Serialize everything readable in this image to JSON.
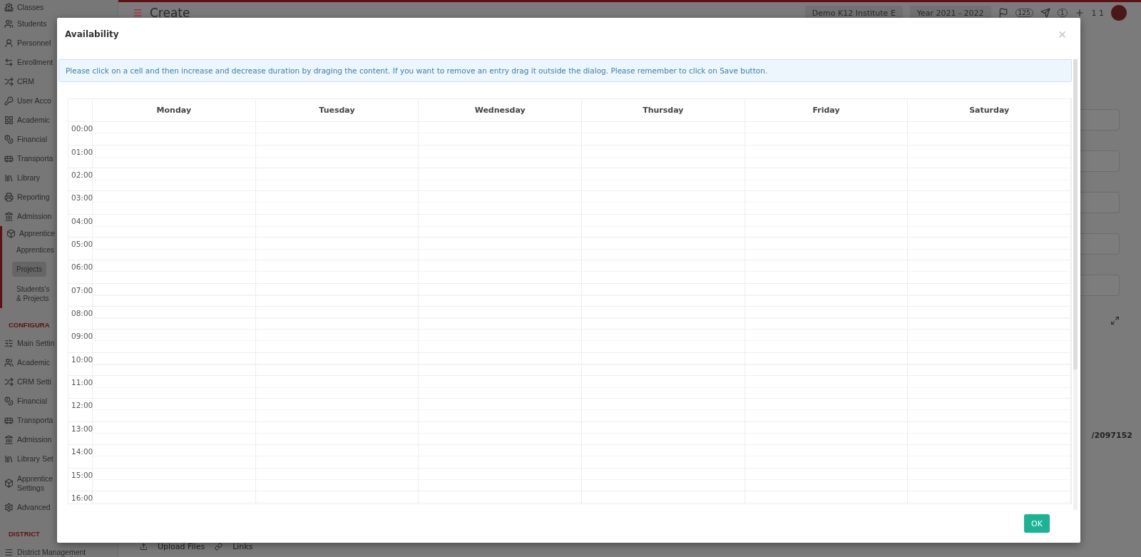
{
  "sidebar": {
    "items": [
      {
        "kind": "item",
        "label": "Classes"
      },
      {
        "kind": "item",
        "label": "Students"
      },
      {
        "kind": "item",
        "label": "Personnel"
      },
      {
        "kind": "item",
        "label": "Enrollment"
      },
      {
        "kind": "item",
        "label": "CRM"
      },
      {
        "kind": "item",
        "label": "User Acco"
      },
      {
        "kind": "item",
        "label": "Academic"
      },
      {
        "kind": "item",
        "label": "Financial"
      },
      {
        "kind": "item",
        "label": "Transporta"
      },
      {
        "kind": "item",
        "label": "Library"
      },
      {
        "kind": "item",
        "label": "Reporting"
      },
      {
        "kind": "item",
        "label": "Admission"
      },
      {
        "kind": "group",
        "label": "Apprentice",
        "expanded": true,
        "children": [
          {
            "label": "Apprentices",
            "selected": false
          },
          {
            "label": "Projects",
            "selected": true
          },
          {
            "label": "Students's\n& Projects",
            "selected": false
          }
        ]
      },
      {
        "kind": "section",
        "label": "CONFIGURA"
      },
      {
        "kind": "item",
        "label": "Main Settin"
      },
      {
        "kind": "item",
        "label": "Academic"
      },
      {
        "kind": "item",
        "label": "CRM Setti"
      },
      {
        "kind": "item",
        "label": "Financial"
      },
      {
        "kind": "item",
        "label": "Transporta"
      },
      {
        "kind": "item",
        "label": "Admission"
      },
      {
        "kind": "item",
        "label": "Library Set"
      },
      {
        "kind": "item",
        "label": "Apprentice\nSettings"
      },
      {
        "kind": "item",
        "label": "Advanced"
      },
      {
        "kind": "section",
        "label": "DISTRICT"
      },
      {
        "kind": "item",
        "label": "District Management"
      }
    ]
  },
  "topbar": {
    "title": "Create",
    "institute": "Demo K12 Institute E",
    "year": "Year 2021 - 2022",
    "messages_count": "125",
    "notifications_count": "1",
    "user": "1 1"
  },
  "form": {
    "counter": "/2097152",
    "tabs": [
      "Upload Files",
      "Links"
    ]
  },
  "dialog": {
    "title": "Availability",
    "message": "Please click on a cell and then increase and decrease duration by draging the content. If you want to remove an entry drag it outside the dialog. Please remember to click on Save button.",
    "days": [
      "Monday",
      "Tuesday",
      "Wednesday",
      "Thursday",
      "Friday",
      "Saturday"
    ],
    "hours": [
      "00:00",
      "01:00",
      "02:00",
      "03:00",
      "04:00",
      "05:00",
      "06:00",
      "07:00",
      "08:00",
      "09:00",
      "10:00",
      "11:00",
      "12:00",
      "13:00",
      "14:00",
      "15:00",
      "16:00"
    ],
    "ok_label": "OK"
  }
}
